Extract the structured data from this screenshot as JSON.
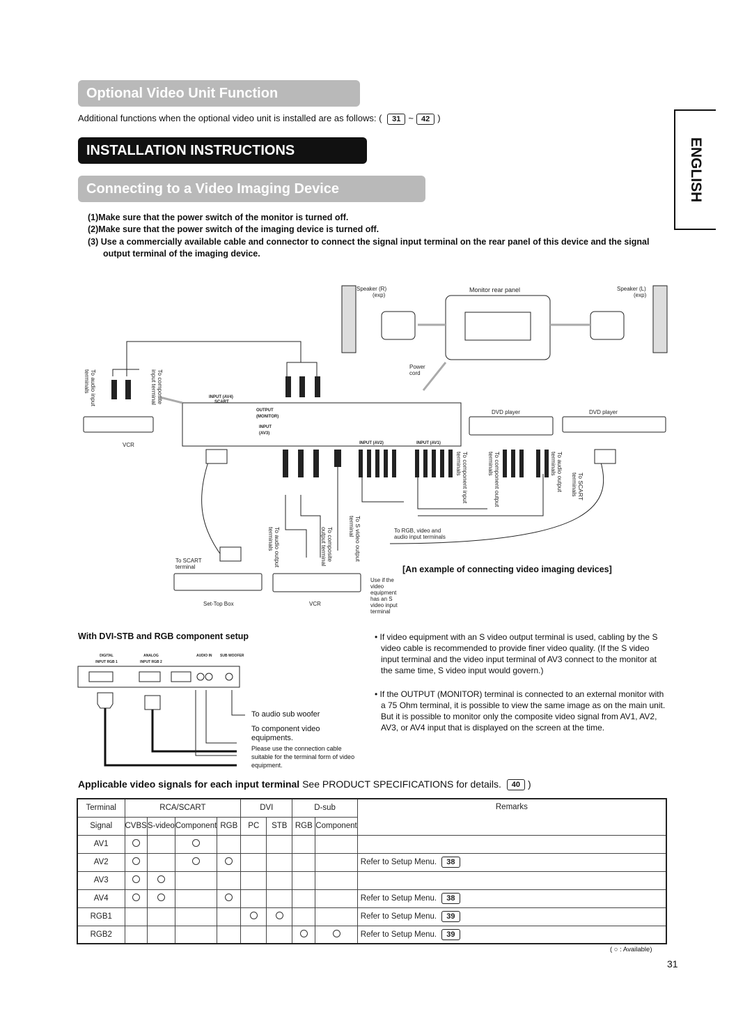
{
  "optional": {
    "title": "Optional Video Unit Function",
    "desc": "Additional functions when the optional video unit is installed are as follows: (",
    "page_from": "31",
    "tilde": "~",
    "page_to": "42",
    "close": ")"
  },
  "install_title": "INSTALLATION INSTRUCTIONS",
  "connect_title": "Connecting to a Video Imaging Device",
  "language_tab": "ENGLISH",
  "steps": [
    {
      "num": "(1)",
      "text": "Make sure that the power switch of the monitor is turned off."
    },
    {
      "num": "(2)",
      "text": "Make sure that the power switch of the imaging device is turned off."
    },
    {
      "num": "(3)",
      "text": "Use a commercially available cable and connector to connect the signal input terminal on the rear panel of this device and the signal output terminal of the imaging device."
    }
  ],
  "diagram": {
    "speaker_r": "Speaker (R)",
    "speaker_l": "Speaker (L)",
    "exp": "(exp)",
    "monitor_rear": "Monitor rear panel",
    "power_cord": "Power cord",
    "to_audio_input": "To audio input terminals",
    "to_composite_input": "To composite input terminal",
    "vcr": "VCR",
    "input_av4": "INPUT (AV4)",
    "scart": "SCART",
    "output_monitor": "OUTPUT (MONITOR)",
    "input_av3": "INPUT (AV3)",
    "input_av2": "INPUT (AV2)",
    "input_av1": "INPUT (AV1)",
    "dvd_player": "DVD player",
    "to_component_input": "To component input terminals",
    "to_component_output": "To component output terminals",
    "to_audio_output": "To audio output terminals",
    "to_scart": "To SCART terminals",
    "to_audio_output2": "To audio output terminals",
    "to_composite_output": "To composite output terminal",
    "to_svideo_output": "To S video output terminal",
    "to_rgb": "To RGB, video and audio input terminals",
    "to_scart_terminal": "To SCART terminal",
    "set_top_box": "Set-Top Box",
    "vcr2": "VCR",
    "use_if": "Use if the video equipment has an S video input terminal",
    "caption": "[An example of connecting video imaging devices]"
  },
  "dvi": {
    "title": "With DVI-STB and RGB component setup",
    "digital": "DIGITAL INPUT RGB 1",
    "analog": "ANALOG INPUT RGB 2",
    "audio_in": "AUDIO IN",
    "sub": "SUB WOOFER",
    "to_sub": "To audio sub woofer",
    "to_comp": "To component video equipments.",
    "note": "Please use the connection cable suitable for the terminal form of video equipment."
  },
  "bullets": [
    "If video equipment with an S video output terminal is used, cabling by the S video cable is recommended to provide finer video quality. (If the S video input terminal and the video input terminal of AV3 connect to the monitor at the same time, S video input would govern.)",
    "If the OUTPUT (MONITOR) terminal is connected to an external monitor with a 75 Ohm terminal, it is possible to view the same image as on the main unit. But it is possible to monitor only the composite video signal from AV1, AV2, AV3, or AV4 input that is displayed on the screen at the time."
  ],
  "applicable": {
    "bold": "Applicable video signals for each input terminal",
    "rest": "See PRODUCT SPECIFICATIONS for details.",
    "page": "40",
    "close": ")"
  },
  "table": {
    "groups": [
      "Terminal",
      "RCA/SCART",
      "DVI",
      "D-sub",
      "Remarks"
    ],
    "signals": [
      "Signal",
      "CVBS",
      "S-video",
      "Component",
      "RGB",
      "PC",
      "STB",
      "RGB",
      "Component"
    ],
    "rows": [
      {
        "name": "AV1",
        "marks": [
          1,
          0,
          1,
          0,
          0,
          0,
          0,
          0
        ],
        "remark": "",
        "page": ""
      },
      {
        "name": "AV2",
        "marks": [
          1,
          0,
          1,
          1,
          0,
          0,
          0,
          0
        ],
        "remark": "Refer to Setup Menu.",
        "page": "38"
      },
      {
        "name": "AV3",
        "marks": [
          1,
          1,
          0,
          0,
          0,
          0,
          0,
          0
        ],
        "remark": "",
        "page": ""
      },
      {
        "name": "AV4",
        "marks": [
          1,
          1,
          0,
          1,
          0,
          0,
          0,
          0
        ],
        "remark": "Refer to Setup Menu.",
        "page": "38"
      },
      {
        "name": "RGB1",
        "marks": [
          0,
          0,
          0,
          0,
          1,
          1,
          0,
          0
        ],
        "remark": "Refer to Setup Menu.",
        "page": "39"
      },
      {
        "name": "RGB2",
        "marks": [
          0,
          0,
          0,
          0,
          0,
          0,
          1,
          1
        ],
        "remark": "Refer to Setup Menu.",
        "page": "39"
      }
    ],
    "legend": "( ○ : Available)"
  },
  "page_number": "31"
}
